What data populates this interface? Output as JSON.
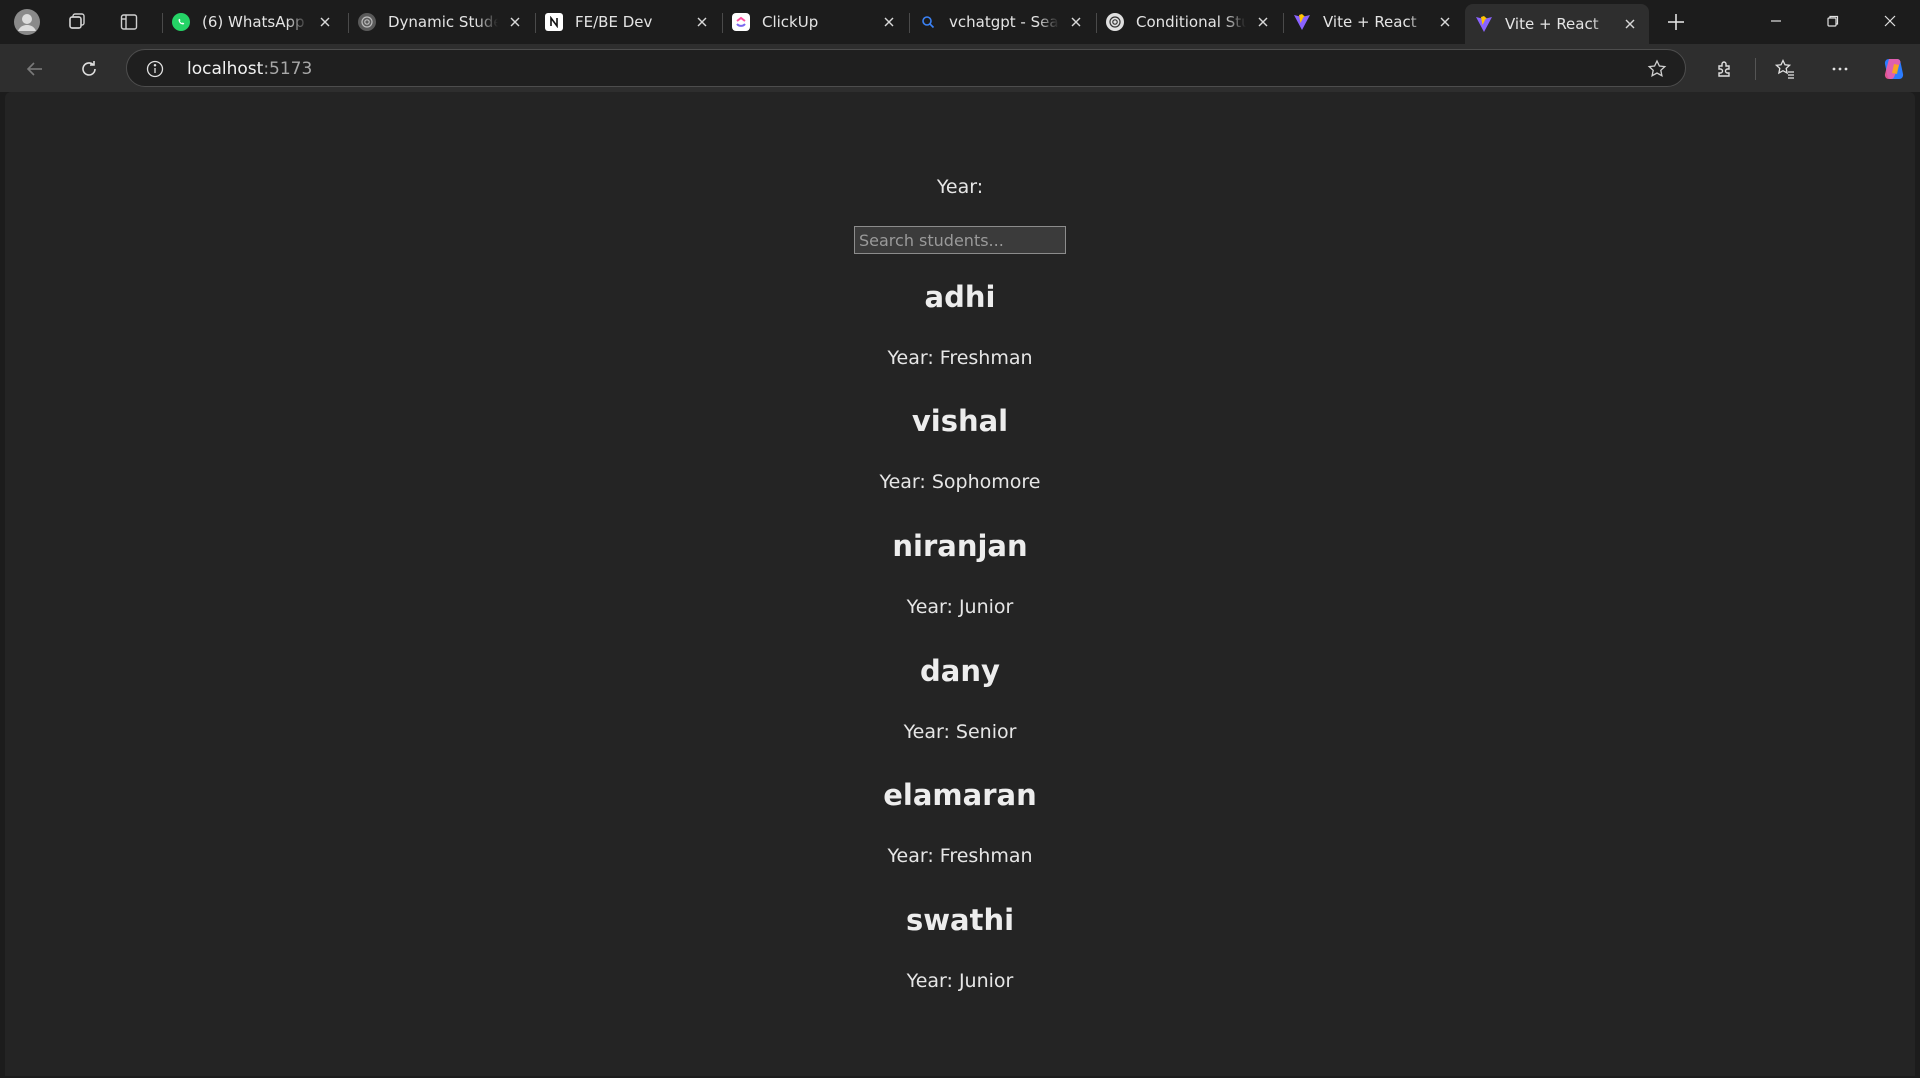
{
  "tabs": [
    {
      "title": "(6) WhatsApp",
      "favicon": "whatsapp-icon",
      "color": "#25d366"
    },
    {
      "title": "Dynamic Student",
      "favicon": "chatgpt-icon",
      "color": "#9a9a9a"
    },
    {
      "title": "FE/BE Dev",
      "favicon": "notion-icon",
      "color": "#ffffff"
    },
    {
      "title": "ClickUp",
      "favicon": "clickup-icon",
      "color": "#7b68ee"
    },
    {
      "title": "vchatgpt - Search",
      "favicon": "search-icon",
      "color": "#3b82f6"
    },
    {
      "title": "Conditional Student",
      "favicon": "chatgpt-icon",
      "color": "#e0e0e0"
    },
    {
      "title": "Vite + React",
      "favicon": "vite-icon",
      "color": "#bd34fe"
    },
    {
      "title": "Vite + React",
      "favicon": "vite-icon",
      "color": "#bd34fe",
      "active": true
    }
  ],
  "address": {
    "host": "localhost",
    "port": ":5173"
  },
  "page": {
    "year_label": "Year:",
    "search_placeholder": "Search students...",
    "students": [
      {
        "name": "adhi",
        "year": "Year: Freshman"
      },
      {
        "name": "vishal",
        "year": "Year: Sophomore"
      },
      {
        "name": "niranjan",
        "year": "Year: Junior"
      },
      {
        "name": "dany",
        "year": "Year: Senior"
      },
      {
        "name": "elamaran",
        "year": "Year: Freshman"
      },
      {
        "name": "swathi",
        "year": "Year: Junior"
      }
    ]
  }
}
